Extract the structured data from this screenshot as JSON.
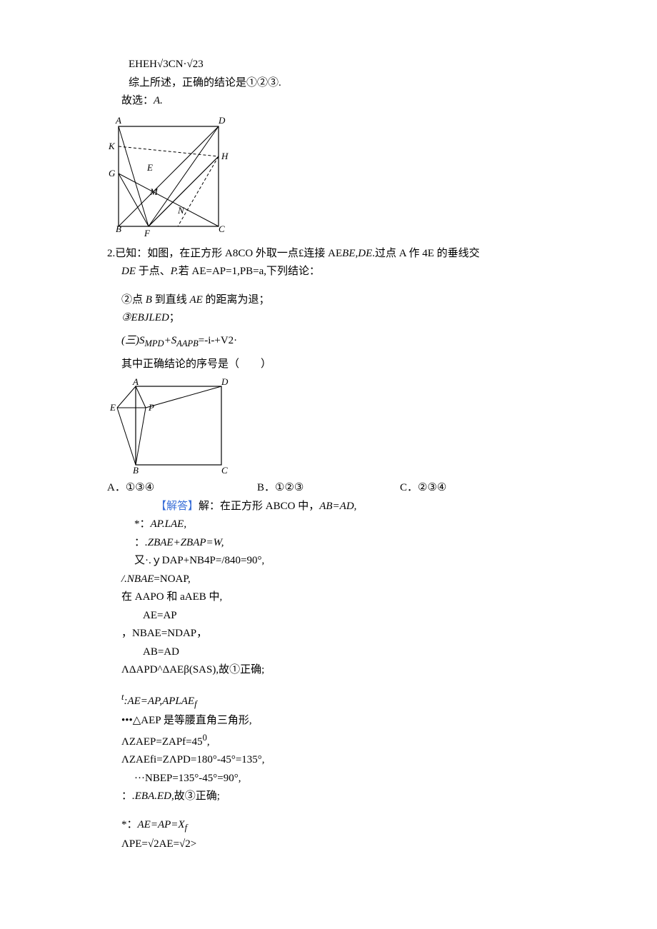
{
  "top": {
    "l1": "EHEH√3CN·√23",
    "l2": "综上所述，正确的结论是①②③.",
    "l3_prefix": "故选：",
    "l3_val": "A."
  },
  "q2": {
    "stem1_prefix": "2.已知：如图，在正方形 A8CO 外取一点£连接 AE",
    "stem1_mid": "BE,DE",
    "stem1_suffix": ".过点 A 作 4E 的垂线交",
    "stem2_de": "DE ",
    "stem2_mid": "于点、",
    "stem2_p": "P.",
    "stem2_tail": "若 AE=AP=1,PB=a,下列结论：",
    "c2_a": "②点 ",
    "c2_b": "B",
    "c2_c": " 到直线 ",
    "c2_d": "AE",
    "c2_e": " 的距离为退；",
    "c3_a": "③",
    "c3_b": "EBJLED",
    "c3_c": "；",
    "c4_a": "(三)S",
    "c4_b": "MPD",
    "c4_c": "+S",
    "c4_d": "A",
    "c4_e": "APB",
    "c4_f": "=-i-+V2·",
    "ask": "其中正确结论的序号是（　　）",
    "choiceA_label": "A．",
    "choiceA": "①③④",
    "choiceB_label": "B．",
    "choiceB": "①②③",
    "choiceC_label": "C．",
    "choiceC": "②③④"
  },
  "sol": {
    "hdr": "【解答】",
    "s1_a": "解：在正方形 ABCO 中，",
    "s1_b": "AB=AD,",
    "s2_a": "*：",
    "s2_b": "AP.LAE,",
    "s3_a": "：",
    "s3_b": ".ZBAE+ZBAP=W,",
    "s4": "又·.ｙDAP+NB4P=/840=90°,",
    "s5_a": "/.NBAE",
    "s5_b": "=NOAP,",
    "s6": "在 AAPO 和 aAEB 中,",
    "s7": "AE=AP",
    "s8": "，NBAE=NDAP，",
    "s9": "AB=AD",
    "s10": "ΛΔAPD^ΔAEβ(SAS),故①正确;",
    "s11_a": "t",
    "s11_b": ":AE=AP,APLAE",
    "s11_c": "f",
    "s12": "•••△AEP 是等腰直角三角形,",
    "s13_a": "ΛZAEP=ZAPf=45",
    "s13_b": "0",
    "s13_c": ",",
    "s14": "ΛZAEfi=ZΛPD=180°-45°=135°,",
    "s15": "···NBEP=135°-45°=90°,",
    "s16_a": "：",
    "s16_b": ".EBA.ED,",
    "s16_c": "故③正确;",
    "s17_a": "*：",
    "s17_b": "AE=AP=X",
    "s17_c": "f",
    "s18": "ΛPE=√2AE=√2>"
  },
  "fig1": {
    "A": "A",
    "B": "B",
    "C": "C",
    "D": "D",
    "E": "E",
    "F": "F",
    "G": "G",
    "H": "H",
    "K": "K",
    "M": "M",
    "N": "N"
  },
  "fig2": {
    "A": "A",
    "B": "B",
    "C": "C",
    "D": "D",
    "E": "E",
    "P": "P"
  }
}
